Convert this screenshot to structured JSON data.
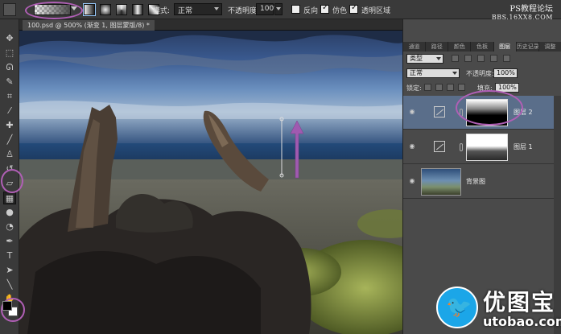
{
  "options_bar": {
    "mode_label": "模式:",
    "mode_value": "正常",
    "opacity_label": "不透明度:",
    "opacity_value": "100%",
    "reverse_label": "反向",
    "dither_label": "仿色",
    "transparency_label": "透明区域",
    "reverse_checked": false,
    "dither_checked": true,
    "transparency_checked": true
  },
  "brand": {
    "line1": "PS教程论坛",
    "line2": "BBS.16XX8.COM"
  },
  "document": {
    "tab_title": "100.psd @ 500% (渐变 1, 图层蒙版/8) *"
  },
  "panels": {
    "tabs": [
      "通道",
      "路径",
      "颜色",
      "色板",
      "图层",
      "历史记录",
      "调整"
    ],
    "active_tab": "图层",
    "kind_filter": "类型",
    "blend_mode": "正常",
    "opacity_label": "不透明度:",
    "opacity_value": "100%",
    "lock_label": "锁定:",
    "fill_label": "填充:",
    "fill_value": "100%"
  },
  "layers": [
    {
      "name": "图层 2",
      "selected": true
    },
    {
      "name": "图层 1",
      "selected": false
    },
    {
      "name": "背景图",
      "selected": false
    }
  ],
  "logo": {
    "cn": "优图宝",
    "en": "utobao.com"
  },
  "colors": {
    "annotation": "#b05fb5",
    "arrow": "#a05ab0",
    "logo_blue": "#1ba6e8"
  }
}
